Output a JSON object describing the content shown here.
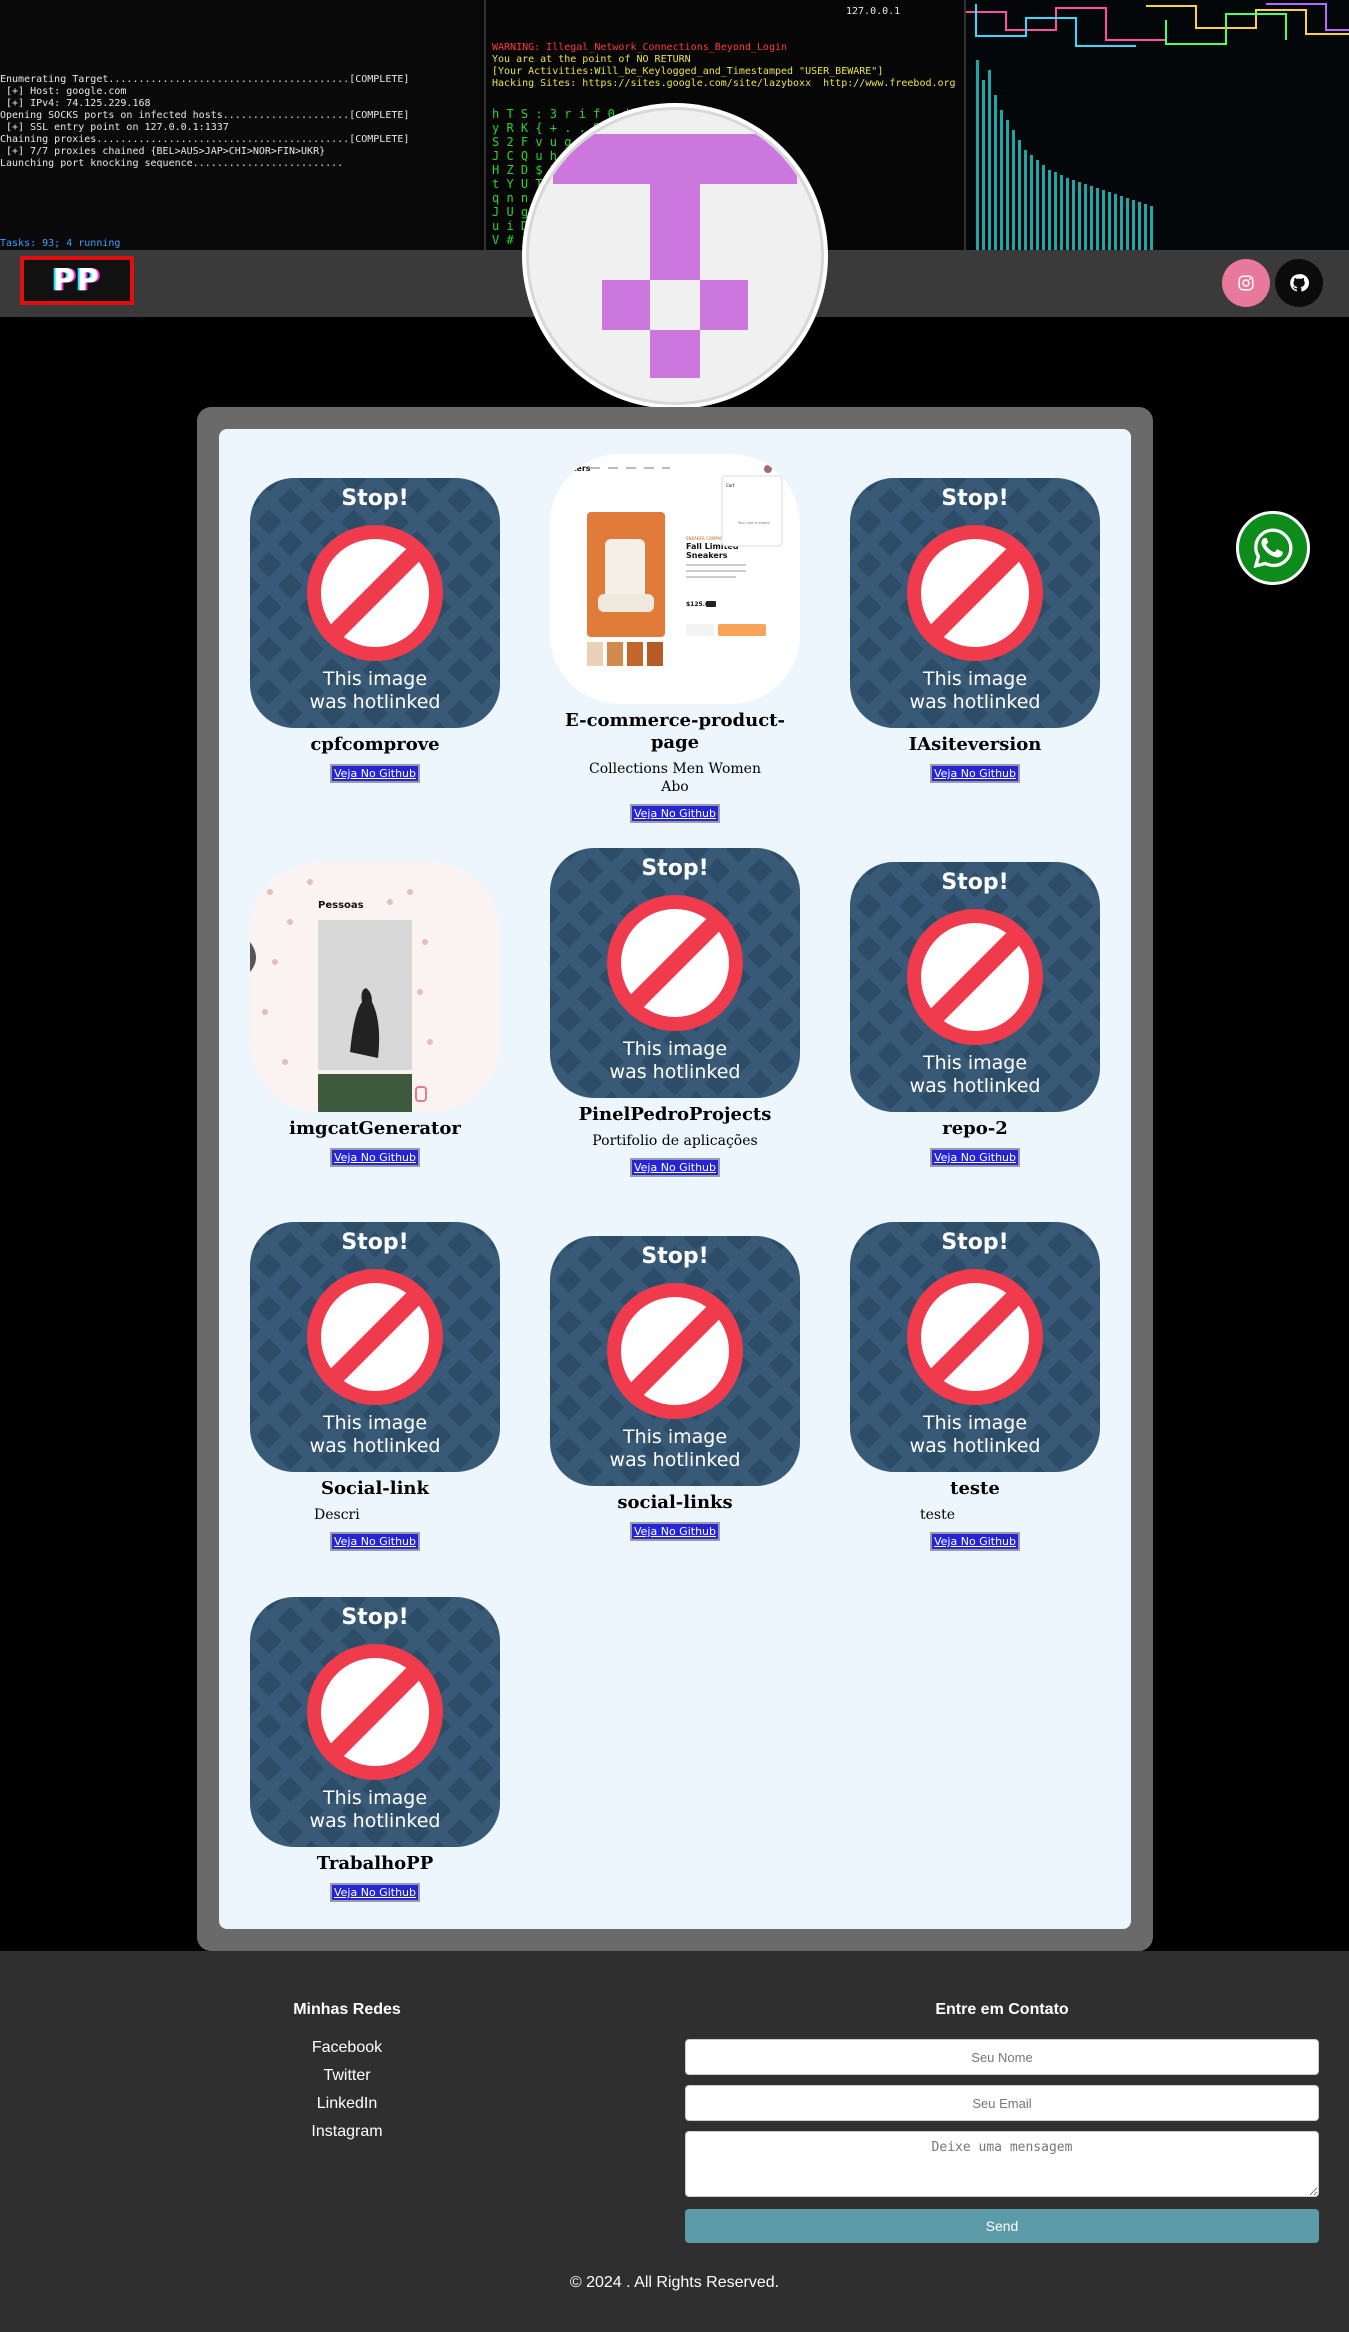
{
  "header": {
    "logo_text": "PP",
    "social": [
      {
        "name": "instagram-icon",
        "color": "#e8799d"
      },
      {
        "name": "github-icon",
        "color": "#0b0b0b"
      }
    ]
  },
  "terminal": {
    "lines": [
      "Enumerating Target........................................[COMPLETE]",
      " [+] Host: google.com",
      " [+] IPv4: 74.125.229.168",
      "Opening SOCKS ports on infected hosts.....................[COMPLETE]",
      " [+] SSL entry point on 127.0.0.1:1337",
      "Chaining proxies..........................................[COMPLETE]",
      " [+] 7/7 proxies chained {BEL>AUS>JAP>CHI>NOR>FIN>UKR}",
      "Launching port knocking sequence........................."
    ],
    "warning": "WARNING: Illegal_Network_Connections_Beyond_Login",
    "warning2": "You are at the point of NO RETURN",
    "warning3": "[Your Activities:Will_be_Keylogged_and_Timestamped \"USER_BEWARE\"]",
    "hacking_sites": "Hacking Sites: https://sites.google.com/site/lazyboxx  http://www.freebod.org",
    "ip": "127.0.0.1",
    "tasks": "Tasks: 93; 4 running"
  },
  "projects": [
    {
      "name": "cpfcomprove",
      "description": "",
      "link_label": "Veja No Github",
      "image": "hotlinked"
    },
    {
      "name": "E-commerce-product-page",
      "description": "Collections Men Women\nAbo",
      "link_label": "Veja No Github",
      "image": "sneakers"
    },
    {
      "name": "IAsiteversion",
      "description": "",
      "link_label": "Veja No Github",
      "image": "hotlinked"
    },
    {
      "name": "imgcatGenerator",
      "description": "",
      "link_label": "Veja No Github",
      "image": "cat"
    },
    {
      "name": "PinelPedroProjects",
      "description": "Portifolio de aplicações",
      "link_label": "Veja No Github",
      "image": "hotlinked"
    },
    {
      "name": "repo-2",
      "description": "",
      "link_label": "Veja No Github",
      "image": "hotlinked"
    },
    {
      "name": "Social-link",
      "description": "Descri",
      "link_label": "Veja No Github",
      "image": "hotlinked"
    },
    {
      "name": "social-links",
      "description": "",
      "link_label": "Veja No Github",
      "image": "hotlinked"
    },
    {
      "name": "teste",
      "description": "teste",
      "link_label": "Veja No Github",
      "image": "hotlinked"
    },
    {
      "name": "TrabalhoPP",
      "description": "",
      "link_label": "Veja No Github",
      "image": "hotlinked"
    }
  ],
  "hotlink_image": {
    "title": "Stop!",
    "caption_line1": "This image",
    "caption_line2": "was hotlinked"
  },
  "sneakers_preview": {
    "brand": "sneakers",
    "heading": "Fall Limited Edition Sneakers",
    "price": "$125.00",
    "cart_label": "Cart",
    "cart_empty": "Your cart is empty"
  },
  "cat_preview": {
    "title": "Pessoas"
  },
  "whatsapp": {
    "icon": "whatsapp-icon"
  },
  "footer": {
    "networks_heading": "Minhas Redes",
    "networks": [
      "Facebook",
      "Twitter",
      "LinkedIn",
      "Instagram"
    ],
    "contact_heading": "Entre em Contato",
    "name_placeholder": "Seu Nome",
    "email_placeholder": "Seu Email",
    "message_placeholder": "Deixe uma mensagem",
    "send_label": "Send",
    "copyright": "© 2024 . All Rights Reserved."
  },
  "colors": {
    "accent": "#cc77dd",
    "link_bg": "#2525d8",
    "send_bg": "#5b9aa7",
    "logo_border": "#e01010"
  }
}
